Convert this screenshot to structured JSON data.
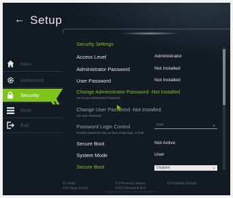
{
  "header": {
    "title": "Setup",
    "back_icon": "back-arrow-icon"
  },
  "sidebar": {
    "items": [
      {
        "label": "Main",
        "icon": "home-icon"
      },
      {
        "label": "Advanced",
        "icon": "gear-icon"
      },
      {
        "label": "Security",
        "icon": "lock-icon",
        "active": true
      },
      {
        "label": "Boot",
        "icon": "list-icon"
      },
      {
        "label": "Exit",
        "icon": "exit-icon"
      }
    ]
  },
  "security": {
    "section_title": "Security Settings",
    "access_level": {
      "label": "Access Level",
      "value": "Administrator"
    },
    "admin_password": {
      "label": "Administrator Password",
      "value": "Not Installed"
    },
    "user_password": {
      "label": "User Password",
      "value": "Not Installed"
    },
    "change_admin": {
      "label": "Change Administrator Password -Not Installed",
      "hint": "Set Setup Administrator Password"
    },
    "change_user": {
      "label": "Change User Password -Not Installed",
      "hint": "Set User Password"
    },
    "password_login": {
      "label": "Password Login Control",
      "value": "Both",
      "hint": "Enables password entry on boot, setup page, or both."
    },
    "secure_boot": {
      "label": "Secure Boot",
      "value": "Not Active"
    },
    "system_mode": {
      "label": "System Mode",
      "value": "User"
    },
    "secure_boot_control": {
      "label": "Secure Boot",
      "value": "Disabled"
    }
  },
  "footer": {
    "help": "F1-Help",
    "save_exit": "F10-Save & Exit",
    "previous": "F3-Previous Values",
    "discard": "ESC-Discard & Exit",
    "optimal": "F9-Optimal Default",
    "copyright": "Copyright (C) 2019 American Megatrends, Inc."
  },
  "colors": {
    "accent": "#7fc31d",
    "background": "#121b24",
    "text": "#e6e6e6"
  }
}
